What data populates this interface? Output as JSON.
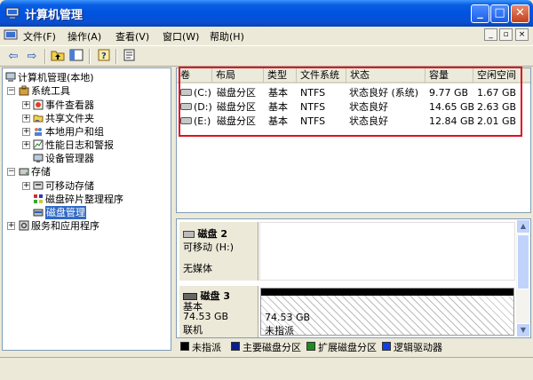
{
  "window": {
    "title": "计算机管理"
  },
  "window_buttons": {
    "minimize": "_",
    "maximize": "□",
    "close": "✕"
  },
  "menubar": {
    "items": [
      "文件(F)",
      "操作(A)",
      "查看(V)",
      "窗口(W)",
      "帮助(H)"
    ],
    "mdi": {
      "minimize": "_",
      "restore": "▫",
      "close": "×"
    }
  },
  "toolbar": {
    "back": "⇦",
    "forward": "⇨"
  },
  "tree": {
    "root": "计算机管理(本地)",
    "system_tools": "系统工具",
    "event_viewer": "事件查看器",
    "shared_folders": "共享文件夹",
    "local_users": "本地用户和组",
    "perf_logs": "性能日志和警报",
    "device_manager": "设备管理器",
    "storage": "存储",
    "removable_storage": "可移动存储",
    "defrag": "磁盘碎片整理程序",
    "disk_management": "磁盘管理",
    "services_apps": "服务和应用程序"
  },
  "volumes": {
    "columns": [
      "卷",
      "布局",
      "类型",
      "文件系统",
      "状态",
      "容量",
      "空闲空间"
    ],
    "rows": [
      {
        "volume": "(C:)",
        "layout": "磁盘分区",
        "type": "基本",
        "fs": "NTFS",
        "status": "状态良好 (系统)",
        "capacity": "9.77 GB",
        "free": "1.67 GB"
      },
      {
        "volume": "(D:)",
        "layout": "磁盘分区",
        "type": "基本",
        "fs": "NTFS",
        "status": "状态良好",
        "capacity": "14.65 GB",
        "free": "2.63 GB"
      },
      {
        "volume": "(E:)",
        "layout": "磁盘分区",
        "type": "基本",
        "fs": "NTFS",
        "status": "状态良好",
        "capacity": "12.84 GB",
        "free": "2.01 GB"
      }
    ]
  },
  "disks": {
    "disk2": {
      "name": "磁盘 2",
      "type": "可移动 (H:)",
      "media": "无媒体"
    },
    "disk3": {
      "name": "磁盘 3",
      "type": "基本",
      "size": "74.53 GB",
      "state": "联机",
      "partition_size": "74.53 GB",
      "partition_state": "未指派"
    }
  },
  "legend": [
    {
      "label": "未指派",
      "color": "#000000"
    },
    {
      "label": "主要磁盘分区",
      "color": "#0a1e8c"
    },
    {
      "label": "扩展磁盘分区",
      "color": "#1e8c1e"
    },
    {
      "label": "逻辑驱动器",
      "color": "#1040e0"
    }
  ]
}
